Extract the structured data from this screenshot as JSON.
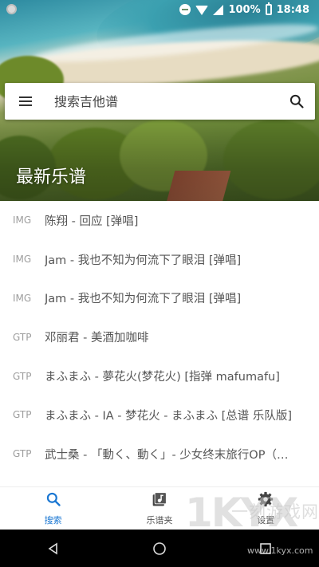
{
  "status_bar": {
    "battery_percent": "100%",
    "time": "18:48"
  },
  "search": {
    "placeholder": "搜索吉他谱"
  },
  "section": {
    "title": "最新乐谱"
  },
  "list": [
    {
      "type": "IMG",
      "title": "陈翔 - 回应 [弹唱]"
    },
    {
      "type": "IMG",
      "title": "Jam - 我也不知为何流下了眼泪 [弹唱]"
    },
    {
      "type": "IMG",
      "title": "Jam - 我也不知为何流下了眼泪 [弹唱]"
    },
    {
      "type": "GTP",
      "title": "邓丽君 - 美酒加咖啡"
    },
    {
      "type": "GTP",
      "title": "まふまふ - 夢花火(梦花火) [指弹 mafumafu]"
    },
    {
      "type": "GTP",
      "title": "まふまふ - IA - 梦花火 - まふまふ [总谱 乐队版]"
    },
    {
      "type": "GTP",
      "title": "武士桑 - 「動く、動く」- 少女终末旅行OP（…"
    }
  ],
  "bottom_nav": {
    "items": [
      {
        "label": "搜索",
        "icon": "search-icon",
        "active": true
      },
      {
        "label": "乐谱夹",
        "icon": "music-library-icon",
        "active": false
      },
      {
        "label": "设置",
        "icon": "gear-icon",
        "active": false
      }
    ]
  },
  "watermark": {
    "logo": "1KYX",
    "text": "一刻游戏网",
    "url": "www.1kyx.com"
  },
  "colors": {
    "accent": "#1976d2",
    "item_type": "#9e9e9e",
    "item_text": "#555555"
  }
}
